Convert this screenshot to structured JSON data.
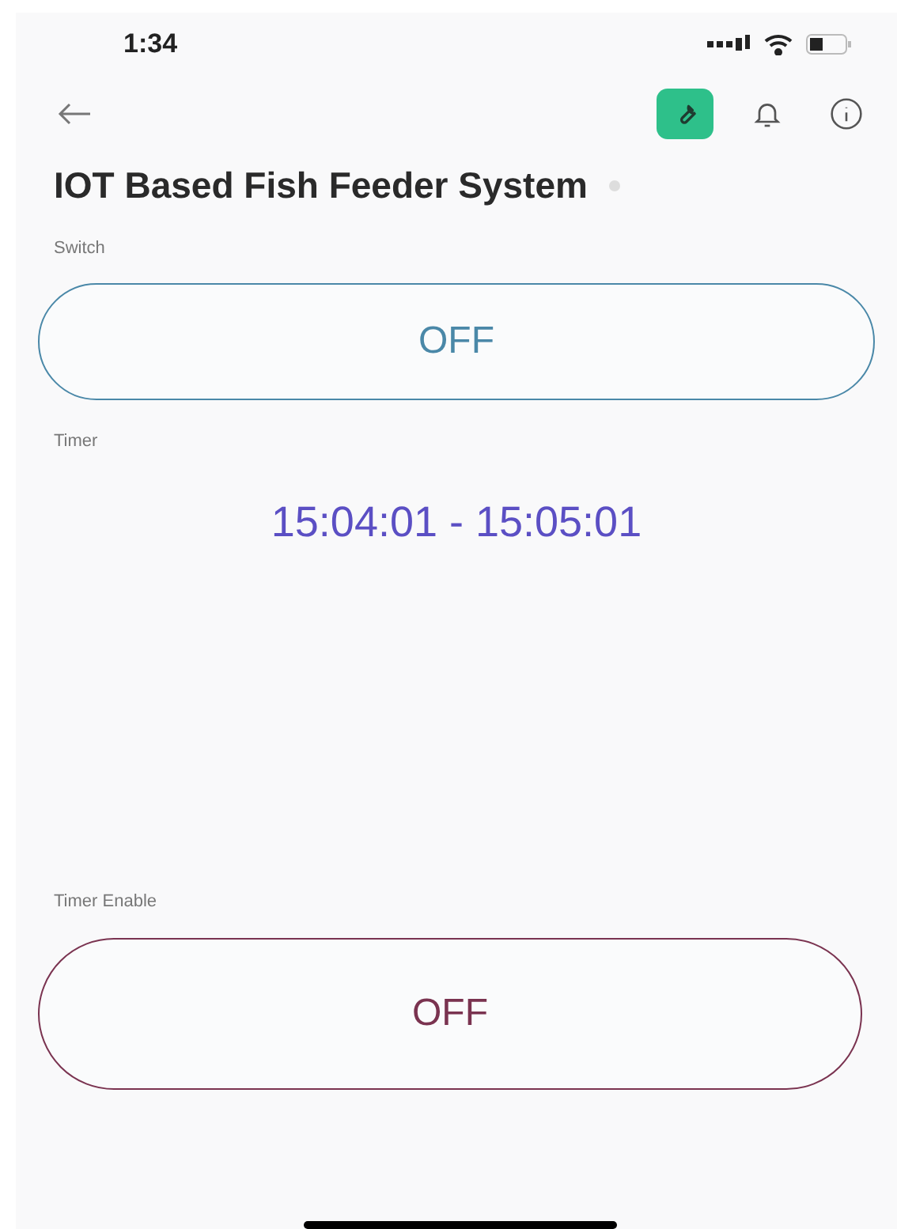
{
  "status_bar": {
    "time": "1:34"
  },
  "toolbar": {
    "tools": [
      {
        "kind": "wrench",
        "selected": true
      },
      {
        "kind": "bell",
        "selected": false
      },
      {
        "kind": "info",
        "selected": false
      }
    ]
  },
  "title": "IOT Based Fish Feeder System",
  "online": false,
  "widgets": [
    {
      "kind": "button",
      "label": "Switch",
      "value": "OFF",
      "color": "#4a88a8"
    },
    {
      "kind": "display",
      "label": "Timer",
      "value": "15:04:01 - 15:05:01",
      "color": "#5b4fc4"
    },
    {
      "kind": "button",
      "label": "Timer Enable",
      "value": "OFF",
      "color": "#7a3350"
    }
  ]
}
